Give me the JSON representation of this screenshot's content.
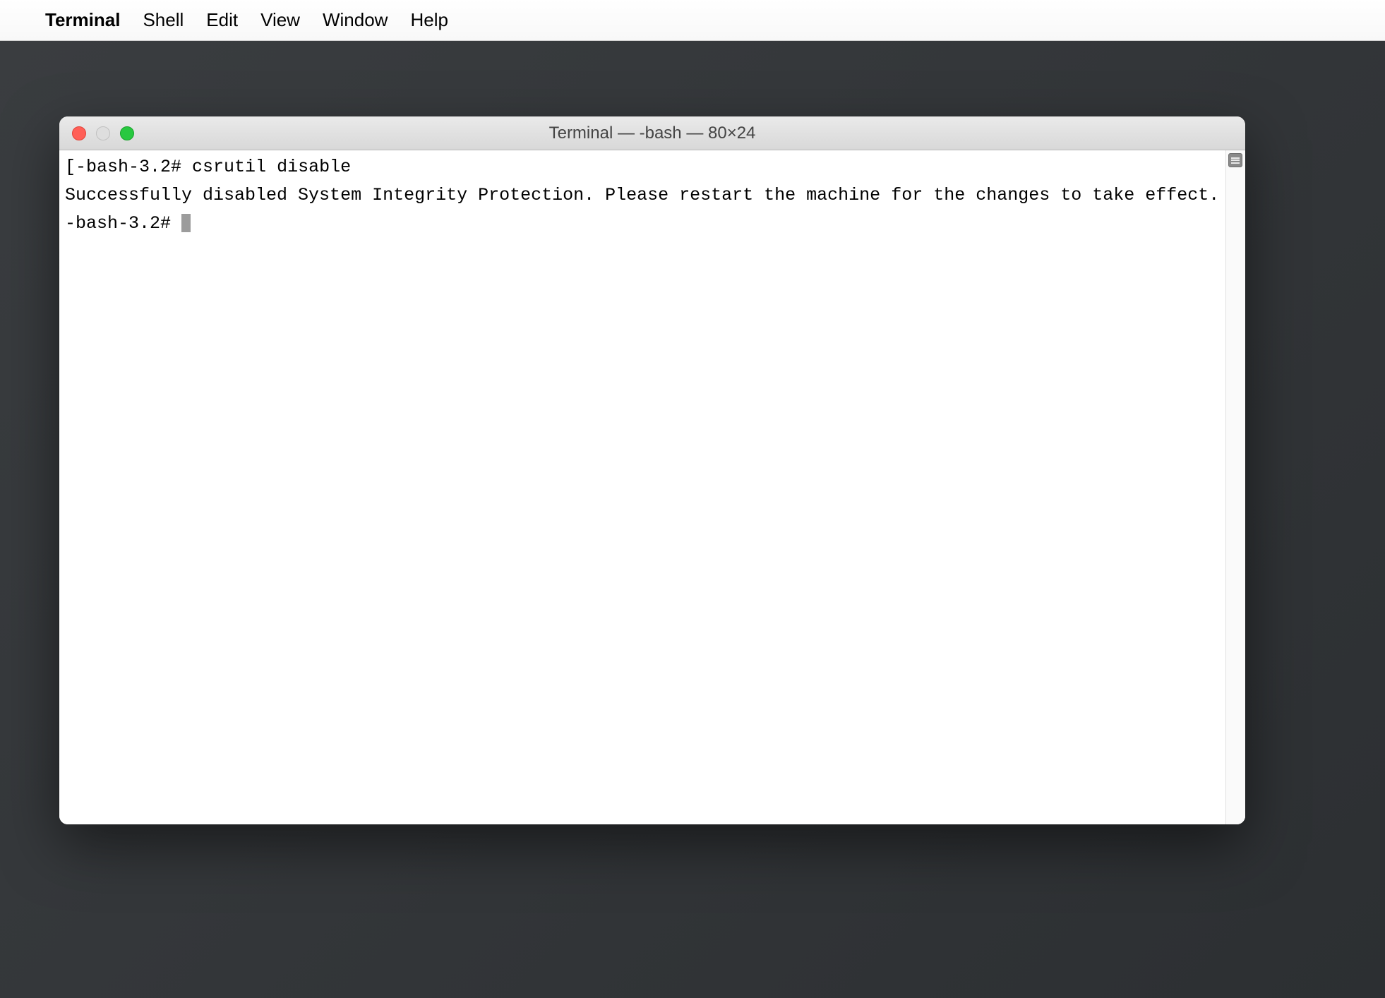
{
  "menubar": {
    "app_name": "Terminal",
    "items": [
      "Shell",
      "Edit",
      "View",
      "Window",
      "Help"
    ]
  },
  "window": {
    "title": "Terminal — -bash — 80×24"
  },
  "terminal": {
    "line1_prefix": "[",
    "line1_prompt": "-bash-3.2# ",
    "line1_command": "csrutil disable",
    "line2": "Successfully disabled System Integrity Protection. Please restart the machine for the changes to take effect.",
    "line3_prompt": "-bash-3.2# "
  }
}
